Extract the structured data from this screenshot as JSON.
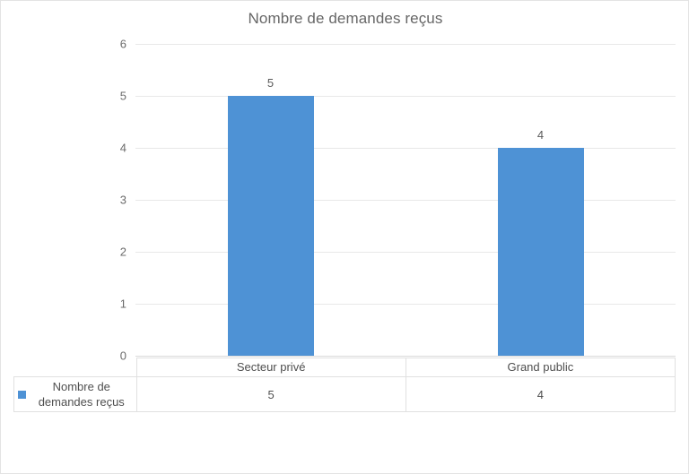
{
  "chart_data": {
    "type": "bar",
    "title": "Nombre de demandes reçus",
    "xlabel": "",
    "ylabel": "",
    "categories": [
      "Secteur privé",
      "Grand public"
    ],
    "series": [
      {
        "name": "Nombre de demandes reçus",
        "values": [
          5,
          4
        ],
        "color": "#4e92d5"
      }
    ],
    "data_labels": [
      "5",
      "4"
    ],
    "ylim": [
      0,
      6
    ],
    "yticks": [
      6,
      5,
      4,
      3,
      2,
      1,
      0
    ],
    "ytick_labels": [
      "6",
      "5",
      "4",
      "3",
      "2",
      "1",
      "0"
    ],
    "grid": true,
    "legend_position": "bottom-left",
    "show_data_table": true
  },
  "table": {
    "legend_label": "Nombre de demandes reçus",
    "column_headers": [
      "Secteur privé",
      "Grand public"
    ],
    "row_values": [
      "5",
      "4"
    ]
  },
  "colors": {
    "bar": "#4e92d5",
    "title_text": "#666666",
    "axis_text": "#6b6b6b",
    "gridline": "#e8e8e8",
    "border": "#e0e0e0"
  }
}
